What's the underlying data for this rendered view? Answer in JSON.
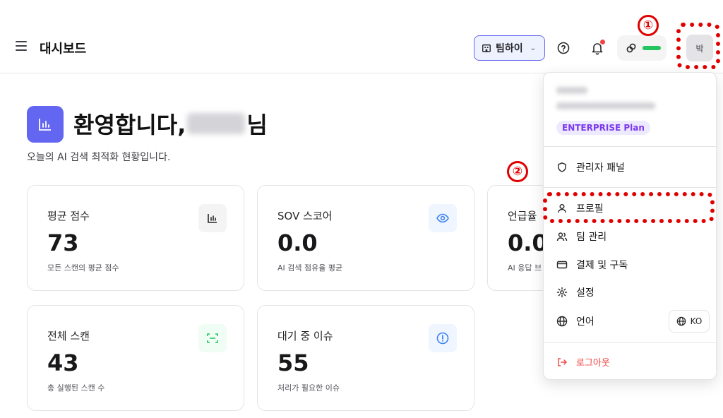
{
  "header": {
    "title": "대시보드",
    "team_label": "팀하이",
    "avatar_text": "박"
  },
  "welcome": {
    "title_prefix": "환영합니다,",
    "title_suffix": "님",
    "subtitle": "오늘의 AI 검색 최적화 현황입니다."
  },
  "cards": [
    {
      "label": "평균 점수",
      "value": "73",
      "desc": "모든 스캔의 평균 점수",
      "icon": "bar-chart-icon"
    },
    {
      "label": "SOV 스코어",
      "value": "0.0",
      "desc": "AI 검색 점유율 평균",
      "icon": "eye-icon"
    },
    {
      "label": "언급율",
      "value": "0.0",
      "desc": "AI 응답 브",
      "icon": "none"
    },
    {
      "label": "전체 스캔",
      "value": "43",
      "desc": "총 실행된 스캔 수",
      "icon": "scan-icon"
    },
    {
      "label": "대기 중 이슈",
      "value": "55",
      "desc": "처리가 필요한 이슈",
      "icon": "alert-circle-icon"
    }
  ],
  "menu": {
    "plan_badge": "ENTERPRISE Plan",
    "items": [
      {
        "label": "관리자 패널",
        "icon": "shield-icon"
      },
      {
        "label": "프로필",
        "icon": "user-icon"
      },
      {
        "label": "팀 관리",
        "icon": "users-icon"
      },
      {
        "label": "결제 및 구독",
        "icon": "credit-card-icon"
      },
      {
        "label": "설정",
        "icon": "gear-icon"
      },
      {
        "label": "언어",
        "icon": "globe-icon"
      }
    ],
    "language_value": "KO",
    "logout_label": "로그아웃"
  },
  "annotations": {
    "marker_1": "①",
    "marker_2": "②"
  },
  "colors": {
    "accent": "#6366f1",
    "status_green": "#22c55e",
    "annotation_red": "#e00000",
    "logout_red": "#ef4444",
    "plan_purple": "#7c3aed"
  }
}
